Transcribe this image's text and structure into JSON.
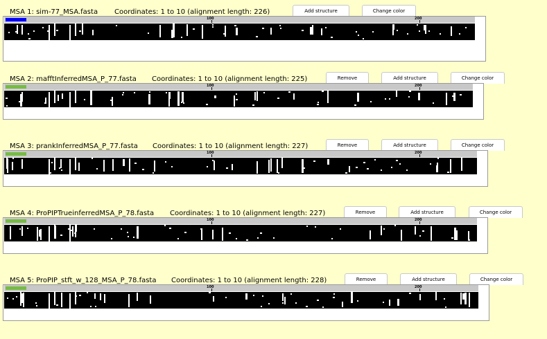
{
  "msas": [
    {
      "title": "MSA 1: sim-77_MSA.fasta",
      "coordinates": "Coordinates: 1  to  10  (alignment length: 226)",
      "buttons": [
        {
          "label": "Add structure"
        },
        {
          "label": "Change color"
        }
      ],
      "color": "#0000ff",
      "ruler_ticks": [
        "100",
        "200"
      ]
    },
    {
      "title": "MSA 2: mafftInferredMSA_P_77.fasta",
      "coordinates": "Coordinates: 1 to 10  (alignment length: 225)",
      "buttons": [
        {
          "label": "Remove"
        },
        {
          "label": "Add structure"
        },
        {
          "label": "Change color"
        }
      ],
      "color": "#77bb44",
      "ruler_ticks": [
        "100",
        "200"
      ]
    },
    {
      "title": "MSA 3: prankInferredMSA_P_77.fasta",
      "coordinates": "Coordinates: 1 to 10  (alignment length: 227)",
      "buttons": [
        {
          "label": "Remove"
        },
        {
          "label": "Add structure"
        },
        {
          "label": "Change color"
        }
      ],
      "color": "#77bb44",
      "ruler_ticks": [
        "100",
        "200"
      ]
    },
    {
      "title": "MSA 4: ProPIPTrueinferredMSA_P_78.fasta",
      "coordinates": "Coordinates: 1 to 10  (alignment length: 227)",
      "buttons": [
        {
          "label": "Remove"
        },
        {
          "label": "Add structure"
        },
        {
          "label": "Change color"
        }
      ],
      "color": "#77bb44",
      "ruler_ticks": [
        "100",
        "200"
      ]
    },
    {
      "title": "MSA 5: ProPIP_stft_w_128_MSA_P_78.fasta",
      "coordinates": "Coordinates: 1 to 10  (alignment length: 228)",
      "buttons": [
        {
          "label": "Remove"
        },
        {
          "label": "Add structure"
        },
        {
          "label": "Change color"
        }
      ],
      "color": "#77bb44",
      "ruler_ticks": [
        "100",
        "200"
      ]
    }
  ]
}
